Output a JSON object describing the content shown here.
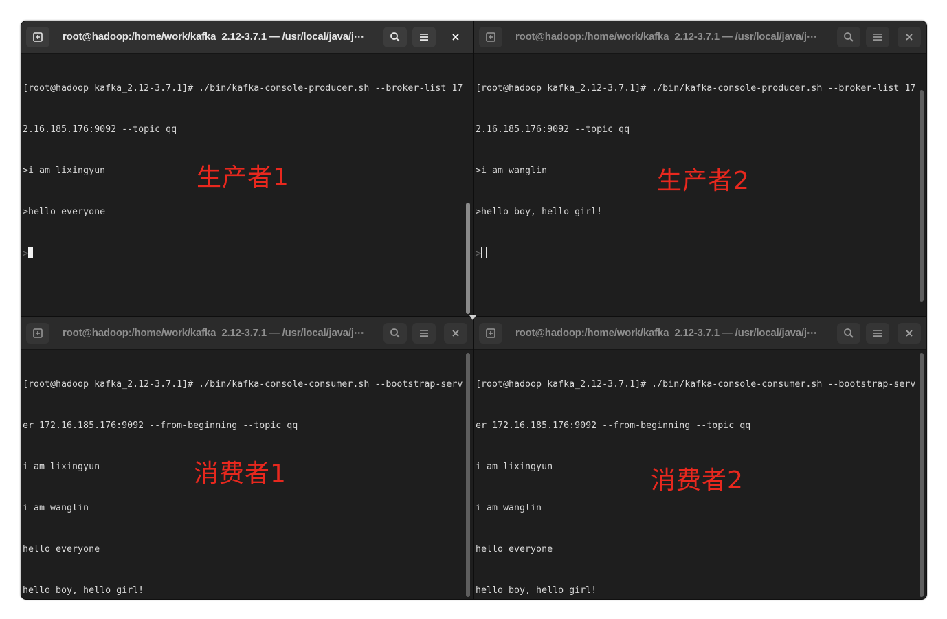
{
  "panes": {
    "top_left": {
      "title": "root@hadoop:/home/work/kafka_2.12-3.7.1 — /usr/local/java/j⋯",
      "lines": [
        "[root@hadoop kafka_2.12-3.7.1]# ./bin/kafka-console-producer.sh --broker-list 17",
        "2.16.185.176:9092 --topic qq",
        ">i am lixingyun",
        ">hello everyone"
      ],
      "prompt": ">",
      "annotation": "生产者1"
    },
    "top_right": {
      "title": "root@hadoop:/home/work/kafka_2.12-3.7.1 — /usr/local/java/j⋯",
      "lines": [
        "[root@hadoop kafka_2.12-3.7.1]# ./bin/kafka-console-producer.sh --broker-list 17",
        "2.16.185.176:9092 --topic qq",
        ">i am wanglin",
        ">hello boy, hello girl!"
      ],
      "prompt": ">",
      "annotation": "生产者2"
    },
    "bottom_left": {
      "title": "root@hadoop:/home/work/kafka_2.12-3.7.1 — /usr/local/java/j⋯",
      "lines": [
        "[root@hadoop kafka_2.12-3.7.1]# ./bin/kafka-console-consumer.sh --bootstrap-serv",
        "er 172.16.185.176:9092 --from-beginning --topic qq",
        "i am lixingyun",
        "i am wanglin",
        "hello everyone",
        "hello boy, hello girl!"
      ],
      "annotation": "消费者1"
    },
    "bottom_right": {
      "title": "root@hadoop:/home/work/kafka_2.12-3.7.1 — /usr/local/java/j⋯",
      "lines": [
        "[root@hadoop kafka_2.12-3.7.1]# ./bin/kafka-console-consumer.sh --bootstrap-serv",
        "er 172.16.185.176:9092 --from-beginning --topic qq",
        "i am lixingyun",
        "i am wanglin",
        "hello everyone",
        "hello boy, hello girl!"
      ],
      "annotation": "消费者2"
    }
  },
  "icons": {
    "new_tab": "new-tab-icon",
    "search": "search-icon",
    "menu": "hamburger-menu-icon",
    "close": "close-icon"
  },
  "colors": {
    "terminal_bg": "#1e1e1e",
    "titlebar_bg": "#303030",
    "text": "#d8d8d8",
    "annotation": "#e8281e"
  }
}
